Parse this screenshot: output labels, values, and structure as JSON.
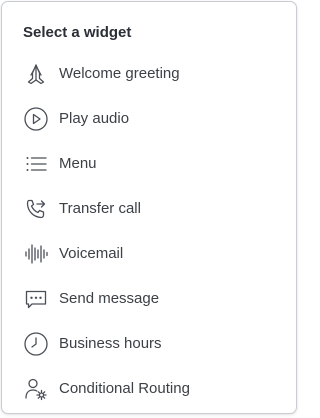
{
  "header": {
    "title": "Select a widget"
  },
  "widgets": [
    {
      "label": "Welcome greeting",
      "icon": "praying-hands-icon"
    },
    {
      "label": "Play audio",
      "icon": "play-circle-icon"
    },
    {
      "label": "Menu",
      "icon": "list-icon"
    },
    {
      "label": "Transfer call",
      "icon": "phone-forward-icon"
    },
    {
      "label": "Voicemail",
      "icon": "waveform-icon"
    },
    {
      "label": "Send message",
      "icon": "message-dots-icon"
    },
    {
      "label": "Business hours",
      "icon": "clock-icon"
    },
    {
      "label": "Conditional Routing",
      "icon": "user-gear-icon"
    }
  ]
}
